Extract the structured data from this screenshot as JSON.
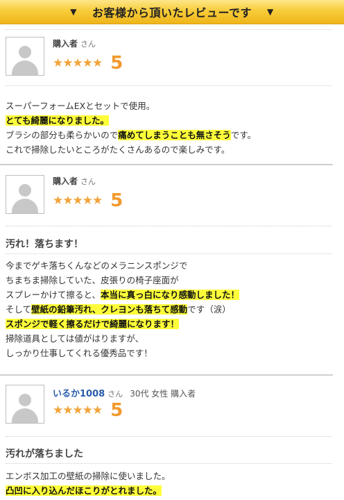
{
  "banner": {
    "title": "お客様から頂いたレビューです",
    "left_arrow": "▼",
    "right_arrow": "▼"
  },
  "reviews": [
    {
      "name": "購入者",
      "san": "さん",
      "meta": "",
      "stars": "★★★★★",
      "score": "5",
      "title": "",
      "lines": [
        [
          {
            "t": "スーパーフォームEXとセットで使用。",
            "h": false
          }
        ],
        [
          {
            "t": "とても綺麗になりました。",
            "h": true
          }
        ],
        [
          {
            "t": "ブラシの部分も柔らかいので",
            "h": false
          },
          {
            "t": "痛めてしまうことも無さそう",
            "h": true
          },
          {
            "t": "です。",
            "h": false
          }
        ],
        [
          {
            "t": "これで掃除したいところがたくさんあるので楽しみです。",
            "h": false
          }
        ]
      ]
    },
    {
      "name": "購入者",
      "san": "さん",
      "meta": "",
      "stars": "★★★★★",
      "score": "5",
      "title": "汚れ！落ちます！",
      "lines": [
        [
          {
            "t": "今までゲキ落ちくんなどのメラニンスポンジで",
            "h": false
          }
        ],
        [
          {
            "t": "ちまちま掃除していた、皮張りの椅子座面が",
            "h": false
          }
        ],
        [
          {
            "t": "スプレーかけて擦ると、",
            "h": false
          },
          {
            "t": "本当に真っ白になり感動しました！",
            "h": true
          }
        ],
        [
          {
            "t": "そして",
            "h": false
          },
          {
            "t": "壁紙の鉛筆汚れ、クレヨンも落ちて感動",
            "h": true
          },
          {
            "t": "です（涙）",
            "h": false
          }
        ],
        [
          {
            "t": "スポンジで軽く擦るだけで綺麗になります！",
            "h": true
          }
        ],
        [
          {
            "t": "掃除道具としては値がはりますが、",
            "h": false
          }
        ],
        [
          {
            "t": "しっかり仕事してくれる優秀品です！",
            "h": false
          }
        ]
      ]
    },
    {
      "name": "いるか1008",
      "san": "さん",
      "meta": "30代 女性  購入者",
      "stars": "★★★★★",
      "score": "5",
      "title": "汚れが落ちました",
      "lines": [
        [
          {
            "t": "エンボス加工の壁紙の掃除に使いました。",
            "h": false
          }
        ],
        [
          {
            "t": "凸凹に入り込んだほこりがとれました。",
            "h": true
          }
        ]
      ]
    }
  ]
}
